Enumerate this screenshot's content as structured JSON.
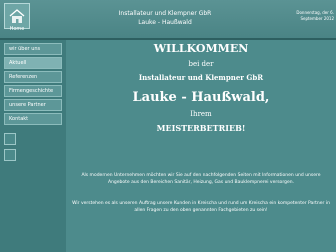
{
  "header": {
    "logo_label": "Home",
    "title_line1": "Installateur und Klempner GbR",
    "title_line2": "Lauke - Haußwald",
    "date_line1": "Donnerstag, der 6.",
    "date_line2": "September 2012"
  },
  "sidebar": {
    "items": [
      {
        "label": "wir über uns"
      },
      {
        "label": "Aktuell"
      },
      {
        "label": "Referenzen"
      },
      {
        "label": "Firmengeschichte"
      },
      {
        "label": "unsere Partner"
      },
      {
        "label": "Kontakt"
      }
    ]
  },
  "main": {
    "welcome": "WILLKOMMEN",
    "bei": "bei der",
    "company": "Installateur und Klempner GbR",
    "names": "Lauke - Haußwald,",
    "ihrem": "Ihrem",
    "meister": "MEISTERBETRIEB!",
    "para1": "Als modernen Unternehmen möchten wir Sie auf den nachfolgenden Seiten mit Informationen und unsere Angebote aus den Bereichen Sanitär, Heizung, Gas und Bauklempnerei versorgen.",
    "para2": "Wir verstehen es als unseren Auftrag unsere Kunden in Kreischa und rund um Kreischa ein kompetenter Partner in allen Fragen zu den oben genannten Fachgebieten zu sein!"
  }
}
